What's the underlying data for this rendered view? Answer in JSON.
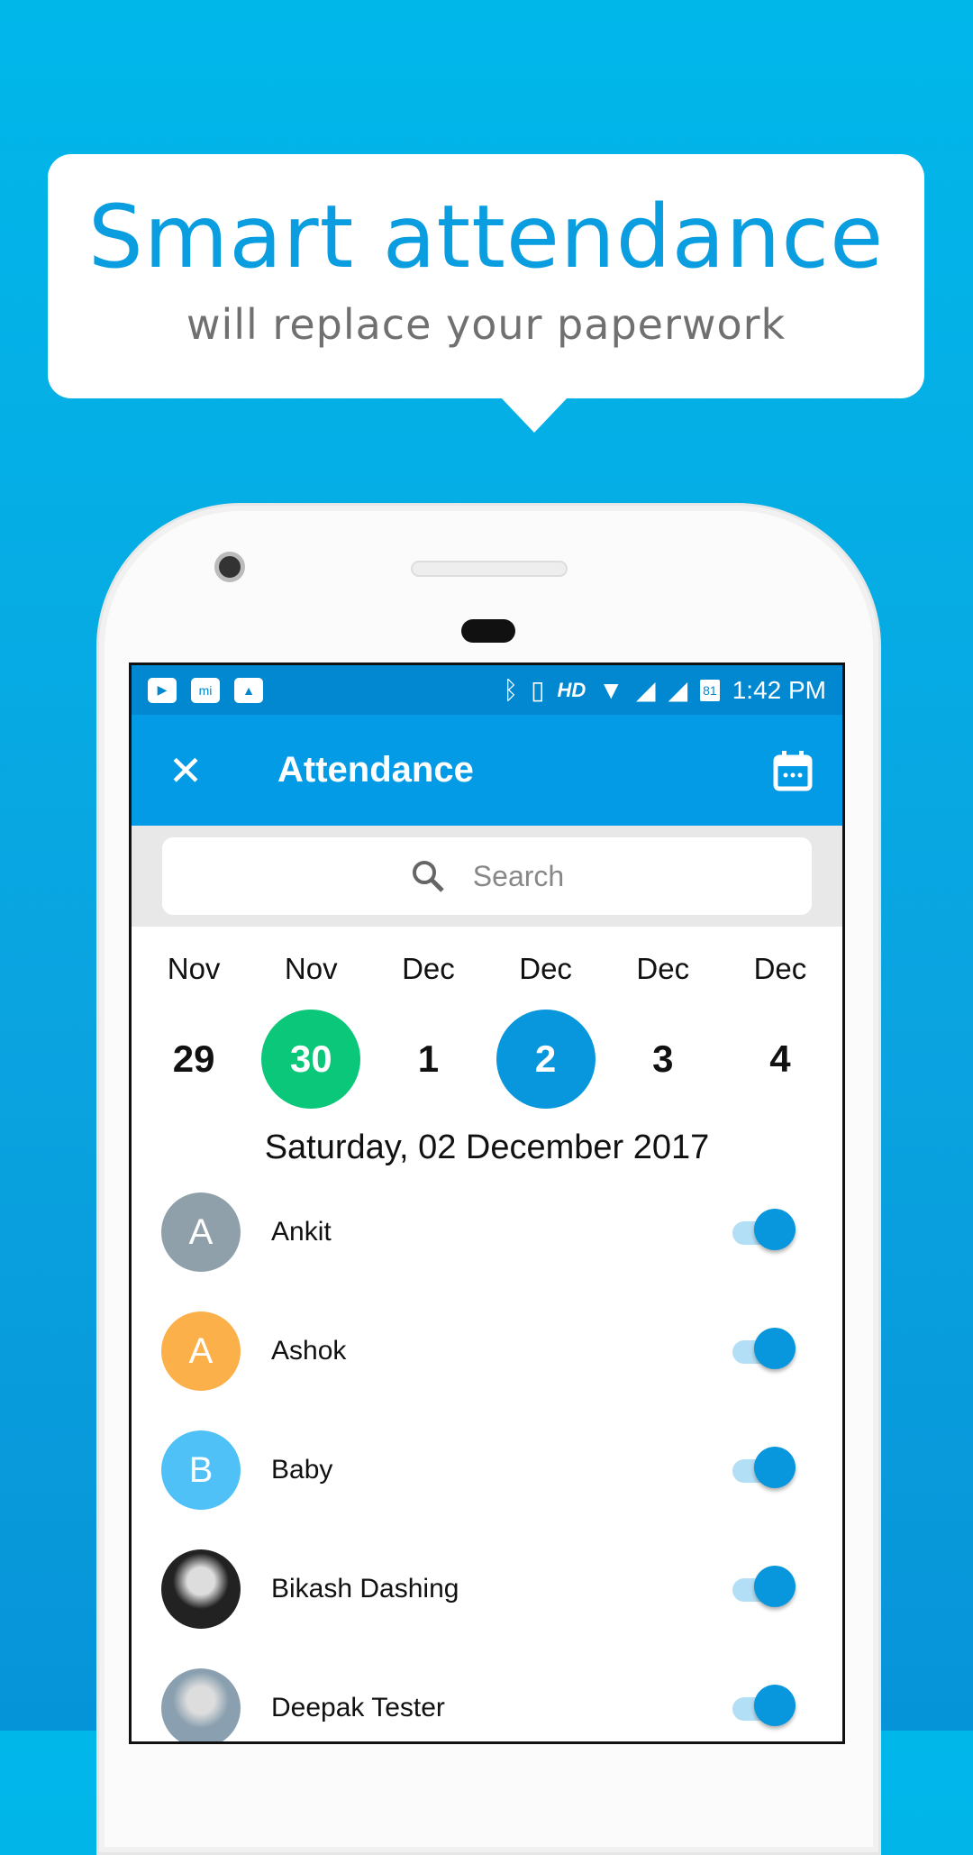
{
  "banner": {
    "headline": "Smart attendance",
    "subline": "will replace your paperwork"
  },
  "status_bar": {
    "time": "1:42 PM",
    "network": "HD",
    "battery": "81",
    "icons": [
      "youtube-icon",
      "mi-icon",
      "gallery-icon",
      "bluetooth-icon",
      "vibrate-icon",
      "wifi-icon",
      "signal-icon",
      "signal-icon",
      "battery-icon"
    ]
  },
  "app_bar": {
    "title": "Attendance",
    "close_icon": "close-icon",
    "calendar_icon": "calendar-icon"
  },
  "search": {
    "placeholder": "Search"
  },
  "dates": [
    {
      "month": "Nov",
      "day": "29",
      "state": "none"
    },
    {
      "month": "Nov",
      "day": "30",
      "state": "green"
    },
    {
      "month": "Dec",
      "day": "1",
      "state": "none"
    },
    {
      "month": "Dec",
      "day": "2",
      "state": "blue"
    },
    {
      "month": "Dec",
      "day": "3",
      "state": "none"
    },
    {
      "month": "Dec",
      "day": "4",
      "state": "none"
    }
  ],
  "selected_date": "Saturday, 02 December 2017",
  "colors": {
    "accent": "#039be5",
    "status": "#0288d1",
    "present_day": "#0bc77a",
    "selected_day": "#0897dd"
  },
  "people": [
    {
      "initial": "A",
      "name": "Ankit",
      "color": "#8fa0aa",
      "present": true
    },
    {
      "initial": "A",
      "name": "Ashok",
      "color": "#fbb04a",
      "present": true
    },
    {
      "initial": "B",
      "name": "Baby",
      "color": "#4fc1f6",
      "present": true
    },
    {
      "initial": "",
      "name": "Bikash Dashing",
      "color": "#222222",
      "present": true
    },
    {
      "initial": "",
      "name": "Deepak Tester",
      "color": "#8aa0b0",
      "present": true
    }
  ]
}
